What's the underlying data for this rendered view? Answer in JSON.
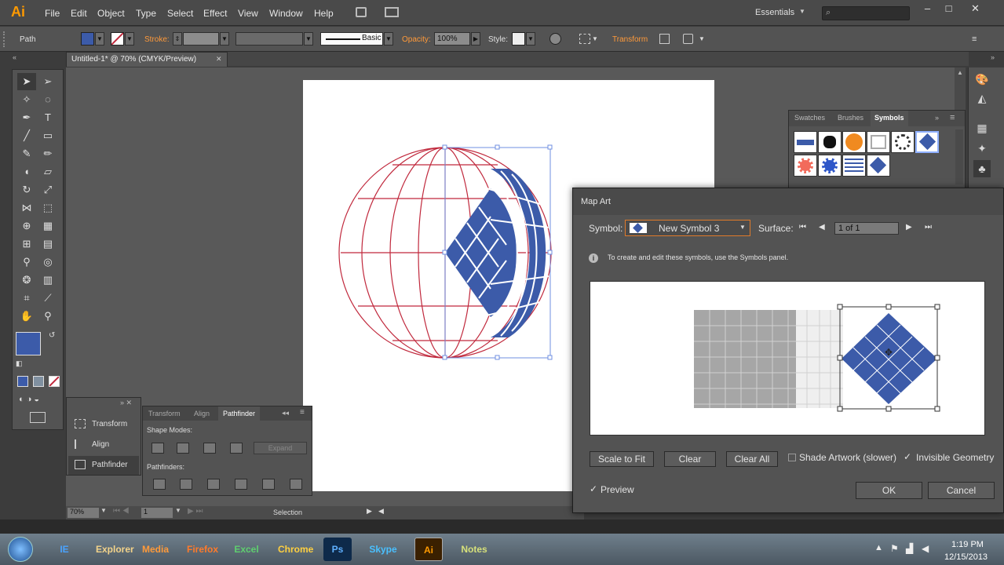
{
  "app": {
    "logo": "Ai",
    "workspace": "Essentials"
  },
  "menu": [
    "File",
    "Edit",
    "Object",
    "Type",
    "Select",
    "Effect",
    "View",
    "Window",
    "Help"
  ],
  "window_controls": [
    "–",
    "□",
    "✕"
  ],
  "control_bar": {
    "selection": "Path",
    "stroke_label": "Stroke:",
    "brush": "Basic",
    "opacity_label": "Opacity:",
    "opacity_value": "100%",
    "style_label": "Style:",
    "transform_label": "Transform"
  },
  "document_tab": {
    "title": "Untitled-1* @ 70% (CMYK/Preview)",
    "close": "✕"
  },
  "left_panel": {
    "items": [
      "Transform",
      "Align",
      "Pathfinder"
    ]
  },
  "pathfinder_panel": {
    "tabs": [
      "Transform",
      "Align",
      "Pathfinder"
    ],
    "shape_modes_label": "Shape Modes:",
    "expand_label": "Expand",
    "pathfinders_label": "Pathfinders:"
  },
  "symbols_panel": {
    "tabs": [
      "Swatches",
      "Brushes",
      "Symbols"
    ]
  },
  "status_bar": {
    "zoom": "70%",
    "artboard": "1",
    "tool": "Selection"
  },
  "dialog": {
    "title": "Map Art",
    "symbol_label": "Symbol:",
    "symbol_value": "New Symbol 3",
    "surface_label": "Surface:",
    "surface_value": "1 of 1",
    "info": "To create and edit these symbols, use the Symbols panel.",
    "buttons": {
      "scale_to_fit": "Scale to Fit",
      "clear": "Clear",
      "clear_all": "Clear All",
      "ok": "OK",
      "cancel": "Cancel"
    },
    "shade_artwork": {
      "label": "Shade Artwork (slower)",
      "checked": false
    },
    "invisible_geometry": {
      "label": "Invisible Geometry",
      "checked": true
    },
    "preview": {
      "label": "Preview",
      "checked": true
    }
  },
  "taskbar": {
    "apps": [
      "IE",
      "Explorer",
      "Media",
      "Firefox",
      "Excel",
      "Chrome",
      "Ps",
      "Skype",
      "Ai",
      "Notes"
    ],
    "time": "1:19 PM",
    "date": "12/15/2013"
  },
  "colors": {
    "accent": "#3c5ba9",
    "stroke_red": "#c0283c",
    "ai_orange": "#ff9a00"
  }
}
